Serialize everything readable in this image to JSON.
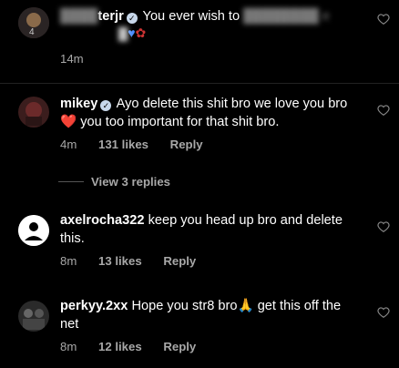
{
  "comments": [
    {
      "username": "terjr",
      "verified": true,
      "text": "You ever wish to",
      "time": "14m",
      "likes": "",
      "reply": ""
    },
    {
      "username": "mikey",
      "verified": true,
      "text_part1": "Ayo delete this shit bro we love you bro",
      "text_emoji": "❤️",
      "text_part2": " you too important for that shit bro.",
      "time": "4m",
      "likes": "131 likes",
      "reply": "Reply",
      "view_replies": "View 3 replies"
    },
    {
      "username": "axelrocha322",
      "verified": false,
      "text": "keep you head up bro and delete this.",
      "time": "8m",
      "likes": "13 likes",
      "reply": "Reply"
    },
    {
      "username": "perkyy.2xx",
      "verified": false,
      "text_part1": "Hope you str8 bro",
      "text_emoji": "🙏",
      "text_part2": " get this off the net",
      "time": "8m",
      "likes": "12 likes",
      "reply": "Reply"
    }
  ],
  "colors": {
    "background": "#000000",
    "meta": "#a8a8a8",
    "verified_badge": "#c7d7ea"
  }
}
